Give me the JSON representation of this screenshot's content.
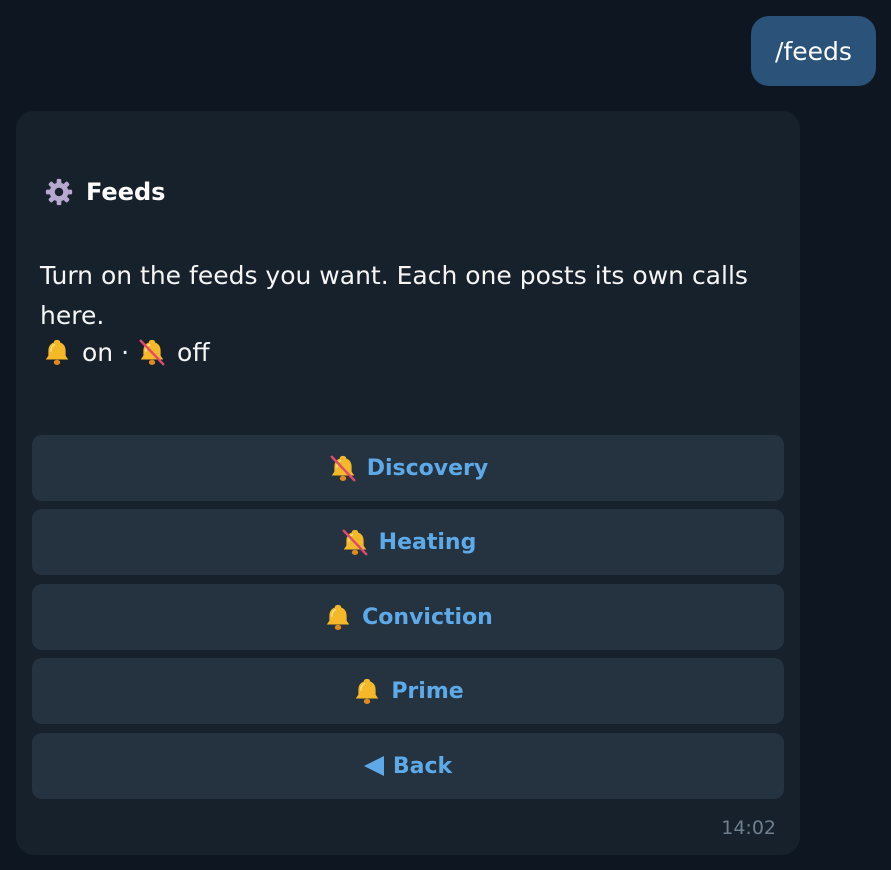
{
  "user_message": {
    "text": "/feeds"
  },
  "bot_message": {
    "title": "Feeds",
    "title_icon": "gear-icon",
    "description": "Turn on the feeds you want. Each one posts its own calls here.",
    "legend": {
      "on_label": "on",
      "separator": "·",
      "off_label": "off"
    },
    "buttons": [
      {
        "label": "Discovery",
        "icon": "bell-off-icon",
        "state": "off"
      },
      {
        "label": "Heating",
        "icon": "bell-off-icon",
        "state": "off"
      },
      {
        "label": "Conviction",
        "icon": "bell-icon",
        "state": "on"
      },
      {
        "label": "Prime",
        "icon": "bell-icon",
        "state": "on"
      },
      {
        "label": "Back",
        "icon": "back-arrow-icon"
      }
    ],
    "time": "14:02"
  },
  "colors": {
    "background": "#0e1621",
    "user_bubble": "#2b5278",
    "bot_bubble": "#17212b",
    "button": "#253341",
    "button_text": "#5eaae8",
    "bell": "#f5b828",
    "strike": "#e14a6d"
  }
}
